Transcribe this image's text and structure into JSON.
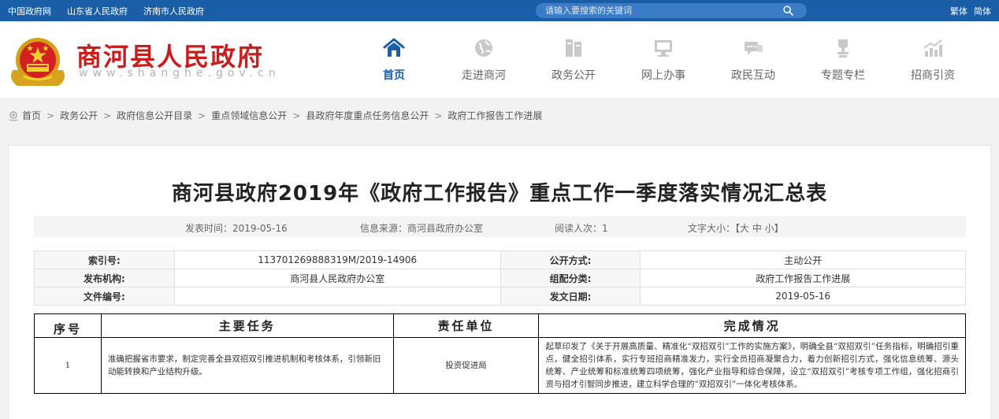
{
  "topbar": {
    "links": [
      "中国政府网",
      "山东省人民政府",
      "济南市人民政府"
    ],
    "search_placeholder": "请输入要搜索的关键词",
    "lang": [
      "繁体",
      "简体"
    ],
    "bg_color": "#1a5ea8"
  },
  "header": {
    "site_title": "商河县人民政府",
    "site_url": "www.shanghe.gov.cn",
    "nav": [
      {
        "label": "首页",
        "icon": "home-icon",
        "active": true
      },
      {
        "label": "走进商河",
        "icon": "globe-icon"
      },
      {
        "label": "政务公开",
        "icon": "folder-icon"
      },
      {
        "label": "网上办事",
        "icon": "monitor-icon"
      },
      {
        "label": "政民互动",
        "icon": "chat-icon"
      },
      {
        "label": "专题专栏",
        "icon": "award-icon"
      },
      {
        "label": "招商引资",
        "icon": "growth-chart-icon"
      }
    ]
  },
  "breadcrumb": [
    "首页",
    "政务公开",
    "政府信息公开目录",
    "重点领域信息公开",
    "县政府年度重点任务信息公开",
    "政府工作报告工作进展"
  ],
  "article": {
    "title": "商河县政府2019年《政府工作报告》重点工作一季度落实情况汇总表",
    "meta": {
      "date": "发表时间：2019-05-16",
      "source": "信息来源：商河县政府办公室",
      "views": "阅读人次：1",
      "font_size": "文字大小：【大 中 小】"
    },
    "info": [
      {
        "k1": "索引号:",
        "v1": "113701269888319M/2019-14906",
        "k2": "公开方式:",
        "v2": "主动公开"
      },
      {
        "k1": "发布机构:",
        "v1": "商河县人民政府办公室",
        "k2": "组配分类:",
        "v2": "政府工作报告工作进展"
      },
      {
        "k1": "文件编号:",
        "v1": "",
        "k2": "发文日期:",
        "v2": "2019-05-16"
      }
    ],
    "table": {
      "headers": [
        "序号",
        "主要任务",
        "责任单位",
        "完成情况"
      ],
      "rows": [
        {
          "no": "1",
          "task": "准确把握省市要求，制定完善全县双招双引推进机制和考核体系，引领新旧动能转换和产业结构升级。",
          "unit": "投资促进局",
          "status": "起草印发了《关于开展高质量、精准化“双招双引”工作的实施方案》，明确全县“双招双引”任务指标，明确招引重点，健全招引体系，实行专班招商精准发力，实行全员招商凝聚合力，着力创新招引方式，强化信息统筹、源头统筹、产业统筹和标准统筹四项统筹，强化产业指导和综合保障，设立“双招双引”考核专项工作组，强化招商引资与招才引智同步推进，建立科学合理的“双招双引”一体化考核体系。"
        }
      ]
    }
  }
}
